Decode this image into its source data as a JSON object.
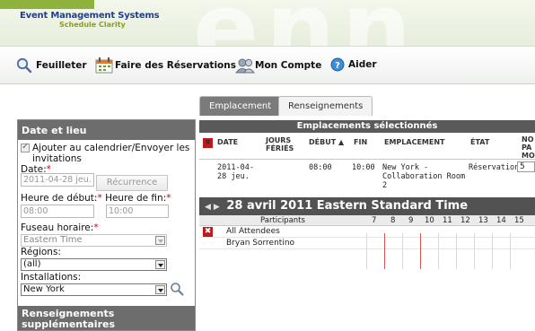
{
  "header": {
    "brand_line1": "Event Management Systems",
    "brand_line2": "Schedule Clarity",
    "watermark": "enn",
    "accent": "#8fb23c"
  },
  "menu": {
    "browse": "Feuilleter",
    "reservations": "Faire des Réservations",
    "account": "Mon Compte",
    "help": "Aider"
  },
  "tabs": {
    "location": "Emplacement",
    "info": "Renseignements"
  },
  "left": {
    "title": "Date et lieu",
    "calendar_label": "Ajouter au calendrier/Envoyer les invitations",
    "date_label": "Date:",
    "date_value": "2011-04-28 jeu.",
    "recurrence_button": "Récurrence",
    "start_label": "Heure de début:",
    "end_label": "Heure de fin:",
    "start_value": "08:00",
    "end_value": "10:00",
    "timezone_label": "Fuseau horaire:",
    "timezone_value": "Eastern Time",
    "regions_label": "Régions:",
    "regions_value": "(all)",
    "facilities_label": "Installations:",
    "facilities_value": "New York",
    "bottom_title": "Renseignements supplémentaires"
  },
  "grid": {
    "selected_header": "Emplacements sélectionnés",
    "columns": {
      "date": "DATE",
      "holidays_1": "JOURS",
      "holidays_2": "FÉRIÉS",
      "start": "DÉBUT ▲",
      "end": "FIN",
      "location": "EMPLACEMENT",
      "state": "ÉTAT",
      "np_1": "NO",
      "np_2": "PA",
      "np_3": "MO"
    },
    "row": {
      "date_1": "2011-04-",
      "date_2": "28 jeu.",
      "start": "08:00",
      "end": "10:00",
      "location_1": "New York -",
      "location_2": "Collaboration Room",
      "location_3": "2",
      "state": "Réservation",
      "count": "5"
    },
    "date_banner": "28 avril 2011 Eastern Standard Time",
    "participants_header": "Participants",
    "hours": [
      "7",
      "8",
      "9",
      "10",
      "11",
      "12",
      "13",
      "14",
      "15"
    ],
    "attendees": [
      "All Attendees",
      "Bryan Sorrentino"
    ],
    "remove_glyph": "✖"
  }
}
